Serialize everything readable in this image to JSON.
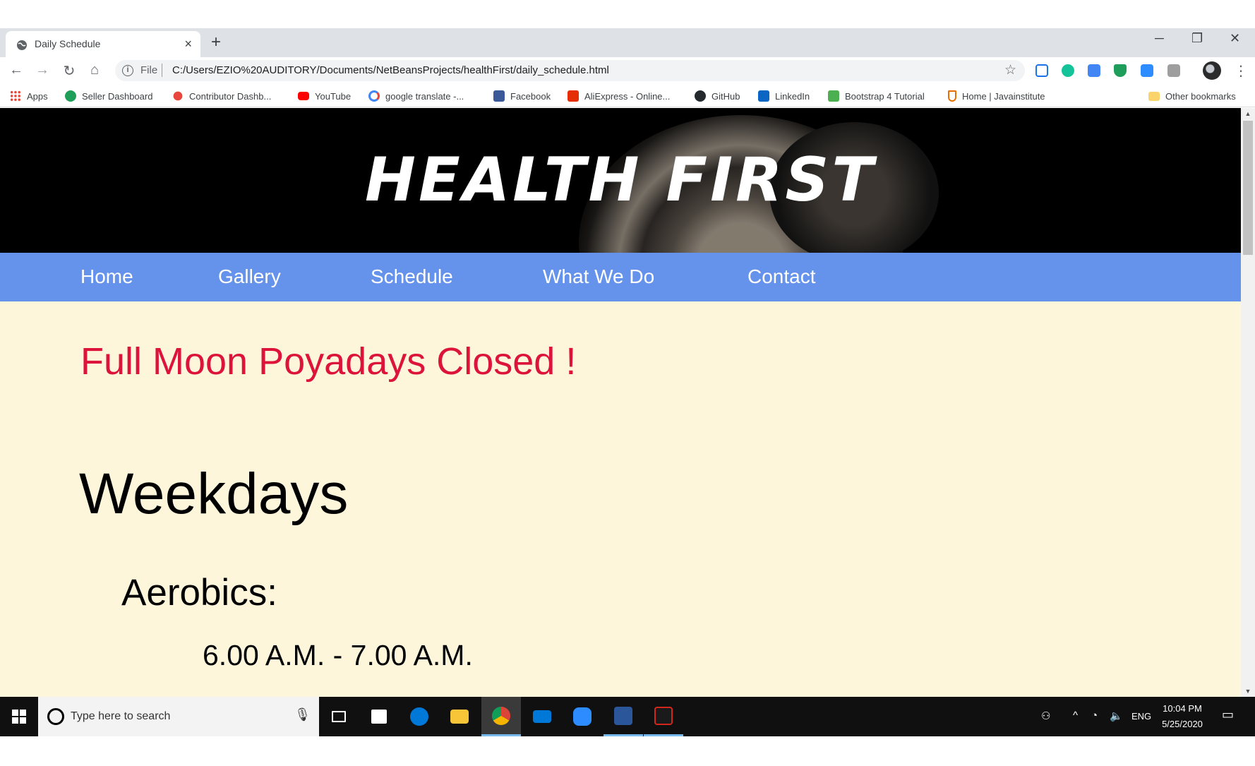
{
  "browser": {
    "tab_title": "Daily Schedule",
    "new_tab": "+",
    "close_tab": "×",
    "window_controls": {
      "minimize": "─",
      "restore": "❐",
      "close": "✕"
    },
    "nav": {
      "back": "←",
      "forward": "→",
      "reload": "↻",
      "home": "⌂"
    },
    "scheme": "File",
    "url": "C:/Users/EZIO%20AUDITORY/Documents/NetBeansProjects/healthFirst/daily_schedule.html",
    "star": "☆",
    "menu": "⋮",
    "extensions": [
      {
        "icon": "reader-icon",
        "color": "#1a73e8"
      },
      {
        "icon": "grammarly-icon",
        "color": "#15c39a"
      },
      {
        "icon": "translate-icon",
        "color": "#4285f4"
      },
      {
        "icon": "shield-icon",
        "color": "#1e9e5a"
      },
      {
        "icon": "zoom-icon",
        "color": "#2d8cff"
      },
      {
        "icon": "pdf-icon",
        "color": "#9e9e9e"
      }
    ]
  },
  "bookmarks": [
    {
      "label": "Apps",
      "icon": "apps-grid-icon",
      "color": "#ea4335"
    },
    {
      "label": "Seller Dashboard",
      "icon": "seller-icon",
      "color": "#1e9e5a"
    },
    {
      "label": "Contributor Dashb...",
      "icon": "contributor-icon",
      "color": "#e8453c"
    },
    {
      "label": "YouTube",
      "icon": "youtube-icon",
      "color": "#ff0000"
    },
    {
      "label": "google translate -...",
      "icon": "google-icon",
      "color": "#4285f4"
    },
    {
      "label": "Facebook",
      "icon": "facebook-icon",
      "color": "#3b5998"
    },
    {
      "label": "AliExpress - Online...",
      "icon": "aliexpress-icon",
      "color": "#e62e04"
    },
    {
      "label": "GitHub",
      "icon": "github-icon",
      "color": "#24292e"
    },
    {
      "label": "LinkedIn",
      "icon": "linkedin-icon",
      "color": "#0a66c2"
    },
    {
      "label": "Bootstrap 4 Tutorial",
      "icon": "w3schools-icon",
      "color": "#4caf50"
    },
    {
      "label": "Home | Javainstitute",
      "icon": "java-icon",
      "color": "#e76f00"
    }
  ],
  "other_bookmarks": "Other bookmarks",
  "page": {
    "logo": "HEALTH FIRST",
    "nav": [
      "Home",
      "Gallery",
      "Schedule",
      "What We Do",
      "Contact"
    ],
    "notice": "Full Moon Poyadays Closed !",
    "section_heading": "Weekdays",
    "activity": "Aerobics:",
    "time": "6.00 A.M. - 7.00 A.M.",
    "colors": {
      "background": "#fef6da",
      "nav": "#6593eb",
      "notice": "#dc143c"
    }
  },
  "taskbar": {
    "search_placeholder": "Type here to search",
    "apps": [
      {
        "name": "task-view-icon",
        "color": "#ffffff"
      },
      {
        "name": "store-icon",
        "color": "#ffffff"
      },
      {
        "name": "edge-icon",
        "color": "#0078d7"
      },
      {
        "name": "file-explorer-icon",
        "color": "#f8c538"
      },
      {
        "name": "chrome-icon",
        "color": "#e5bd2e"
      },
      {
        "name": "mail-icon",
        "color": "#0078d7"
      },
      {
        "name": "zoom-icon",
        "color": "#2d8cff"
      },
      {
        "name": "word-icon",
        "color": "#2b579a"
      },
      {
        "name": "acrobat-icon",
        "color": "#d4271c"
      }
    ],
    "language": "ENG",
    "time": "10:04 PM",
    "date": "5/25/2020"
  }
}
